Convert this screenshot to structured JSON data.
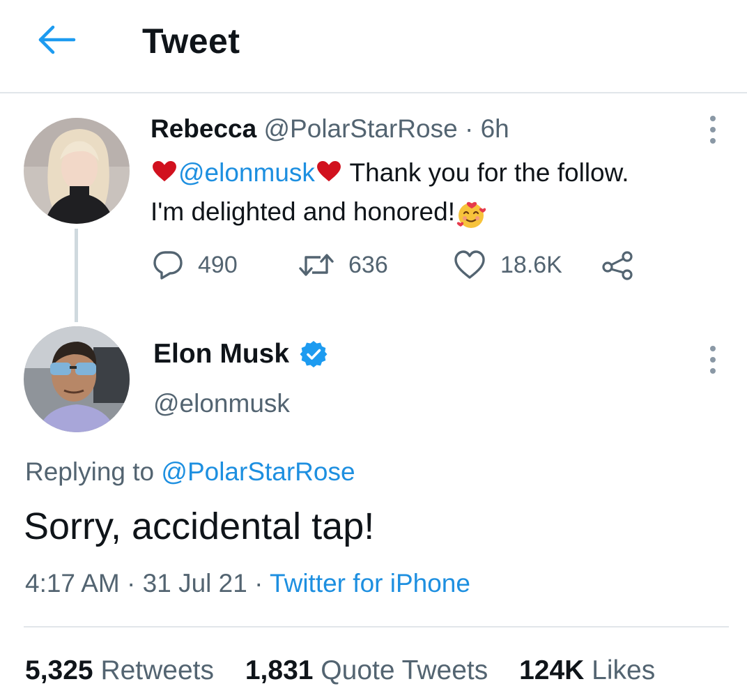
{
  "header": {
    "title": "Tweet",
    "back_icon": "arrow-left-icon",
    "accent": "#1d9bf0"
  },
  "parent_tweet": {
    "name": "Rebecca",
    "handle": "@PolarStarRose",
    "separator": " · ",
    "time": "6h",
    "mention": "@elonmusk",
    "text_after_mention": " Thank you for the follow.",
    "text_line2": "I'm delighted and honored!",
    "heart_icon": "red-heart-icon",
    "emoji_icon": "smiling-face-with-hearts-icon",
    "actions": {
      "replies": "490",
      "retweets": "636",
      "likes": "18.6K"
    }
  },
  "tweet": {
    "name": "Elon Musk",
    "verified_icon": "verified-badge-icon",
    "handle": "@elonmusk",
    "replying_label": "Replying to ",
    "replying_to": "@PolarStarRose",
    "text": "Sorry, accidental tap!",
    "time": "4:17 AM",
    "sep1": " · ",
    "date": "31 Jul 21",
    "sep2": " · ",
    "source": "Twitter for iPhone"
  },
  "stats": {
    "retweets_count": "5,325",
    "retweets_label": " Retweets",
    "quotes_count": "1,831",
    "quotes_label": " Quote Tweets",
    "likes_count": "124K",
    "likes_label": " Likes"
  },
  "colors": {
    "link": "#1d8fe0",
    "muted": "#536471",
    "heart": "#d1111e",
    "verified": "#1d9bf0"
  }
}
